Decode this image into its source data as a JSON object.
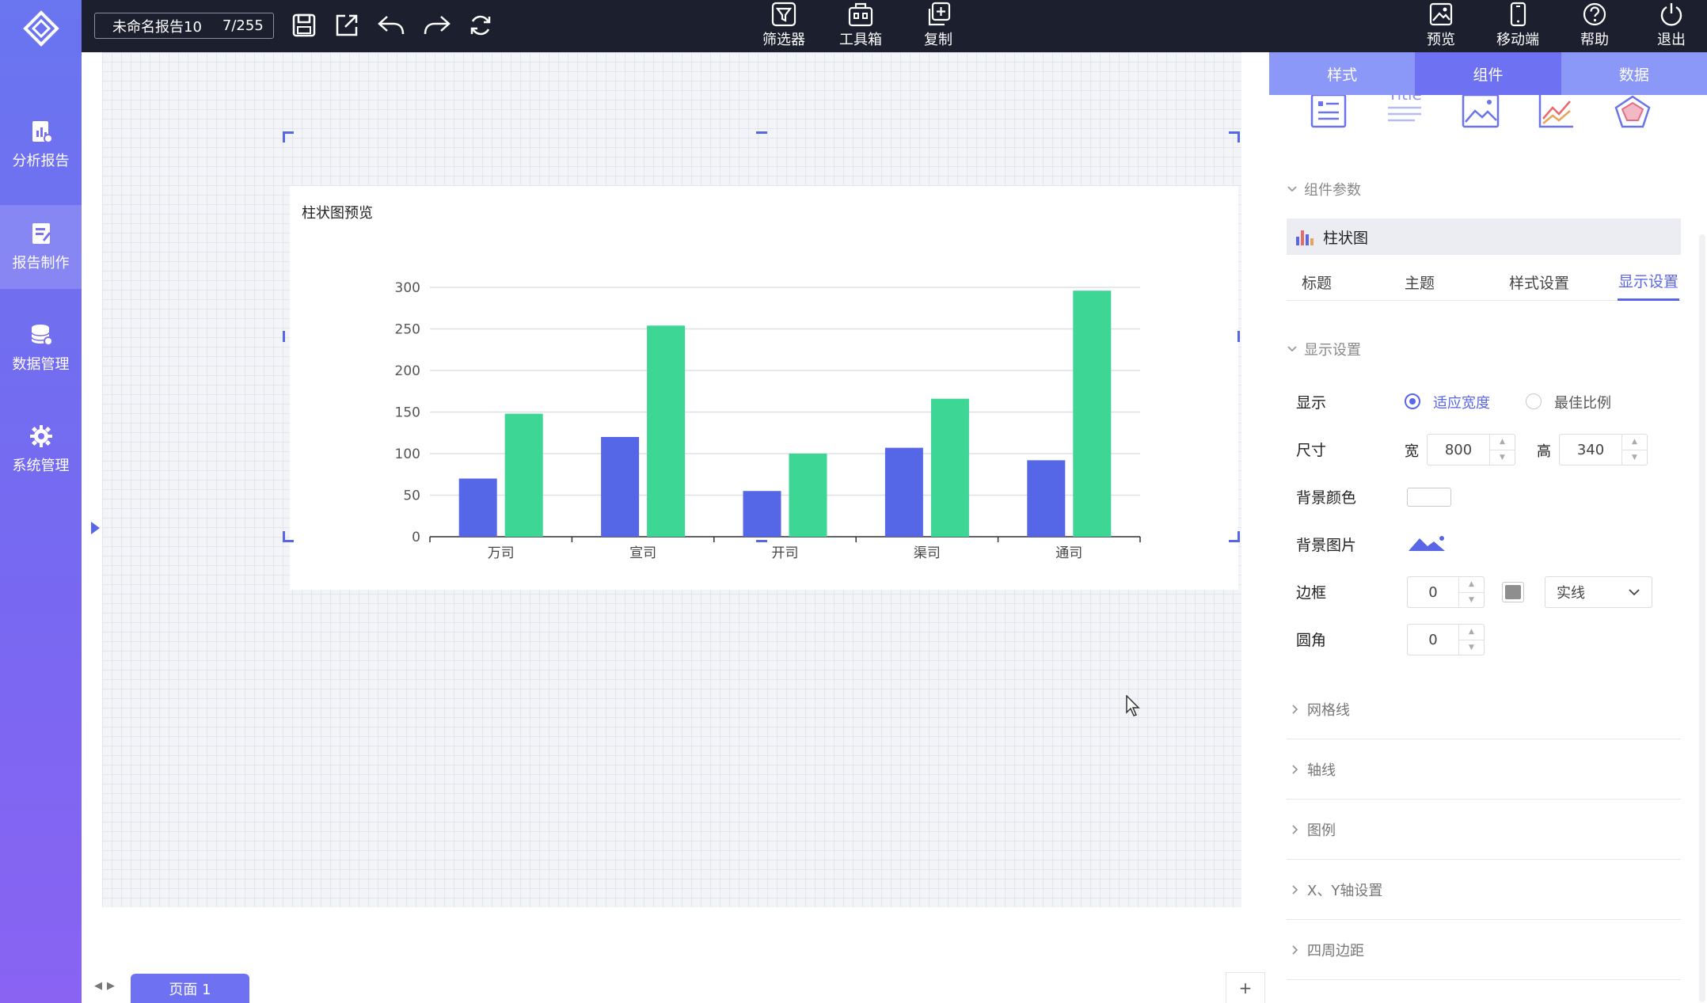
{
  "colors": {
    "accent": "#5a66e8",
    "series_blue": "#5566e6",
    "series_green": "#3dd694",
    "toolbar_bg": "#1c1f2e"
  },
  "sidebar": {
    "items": [
      {
        "label": "分析报告",
        "icon": "report-chart-icon"
      },
      {
        "label": "报告制作",
        "icon": "document-edit-icon"
      },
      {
        "label": "数据管理",
        "icon": "database-icon"
      },
      {
        "label": "系统管理",
        "icon": "gear-icon"
      }
    ]
  },
  "toolbar": {
    "report_name": "未命名报告10",
    "report_count": "7/255",
    "center": [
      {
        "label": "筛选器",
        "icon": "filter-icon"
      },
      {
        "label": "工具箱",
        "icon": "toolbox-icon"
      },
      {
        "label": "复制",
        "icon": "copy-icon"
      }
    ],
    "right": [
      {
        "label": "预览",
        "icon": "preview-icon"
      },
      {
        "label": "移动端",
        "icon": "mobile-icon"
      },
      {
        "label": "帮助",
        "icon": "help-icon"
      },
      {
        "label": "退出",
        "icon": "power-icon"
      }
    ]
  },
  "card": {
    "title": "柱状图预览"
  },
  "chart_data": {
    "type": "bar",
    "categories": [
      "万司",
      "宣司",
      "开司",
      "渠司",
      "通司"
    ],
    "series": [
      {
        "color": "#5566e6",
        "values": [
          70,
          120,
          55,
          107,
          92
        ]
      },
      {
        "color": "#3dd694",
        "values": [
          148,
          254,
          100,
          166,
          296
        ]
      }
    ],
    "y_ticks": [
      0,
      50,
      100,
      150,
      200,
      250,
      300
    ],
    "ylim": [
      0,
      300
    ],
    "grid": true
  },
  "pagebar": {
    "page_label": "页面 1",
    "add_label": "+",
    "nav": "◀▶"
  },
  "panel": {
    "tabs": [
      "样式",
      "组件",
      "数据"
    ],
    "active_tab": 1,
    "component_params_label": "组件参数",
    "chart_type_label": "柱状图",
    "subtabs": [
      "标题",
      "主题",
      "样式设置",
      "显示设置"
    ],
    "display_section_label": "显示设置",
    "display": {
      "label": "显示",
      "option_fit": "适应宽度",
      "option_best": "最佳比例"
    },
    "size": {
      "label": "尺寸",
      "width_label": "宽",
      "width": "800",
      "height_label": "高",
      "height": "340"
    },
    "bg_color_label": "背景颜色",
    "bg_image_label": "背景图片",
    "border": {
      "label": "边框",
      "value": "0",
      "style": "实线"
    },
    "radius": {
      "label": "圆角",
      "value": "0"
    },
    "collapsed_sections": [
      "网格线",
      "轴线",
      "图例",
      "X、Y轴设置",
      "四周边距"
    ]
  }
}
